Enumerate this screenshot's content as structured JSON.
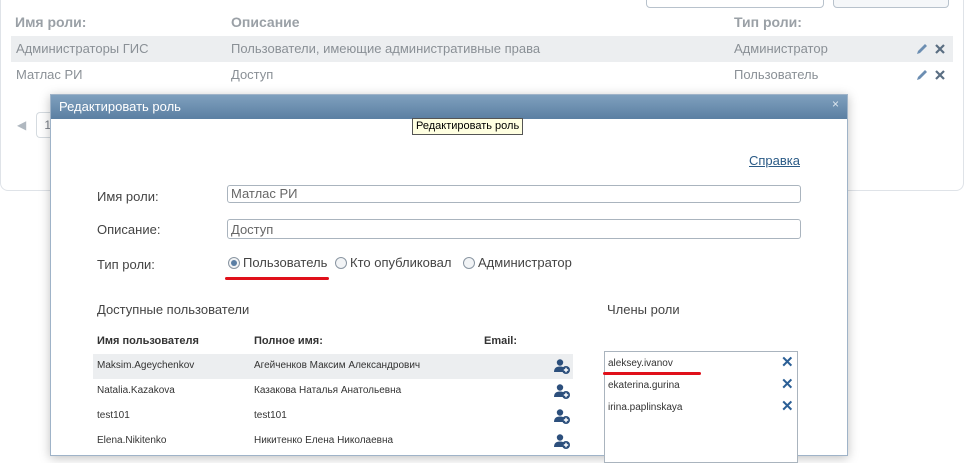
{
  "background": {
    "headers": {
      "role_name": "Имя роли:",
      "description": "Описание",
      "role_type": "Тип роли:"
    },
    "rows": [
      {
        "name": "Администраторы ГИС",
        "description": "Пользователи, имеющие административные права",
        "type": "Администратор"
      },
      {
        "name": "Матлас РИ",
        "description": "Доступ",
        "type": "Пользователь"
      }
    ],
    "pager": {
      "page": "1"
    }
  },
  "dialog": {
    "title": "Редактировать роль",
    "tooltip": "Редактировать роль",
    "help_link": "Справка",
    "labels": {
      "role_name": "Имя роли:",
      "description": "Описание:",
      "role_type": "Тип роли:"
    },
    "values": {
      "role_name": "Матлас РИ",
      "description": "Доступ"
    },
    "role_types": [
      {
        "label": "Пользователь",
        "checked": true
      },
      {
        "label": "Кто опубликовал",
        "checked": false
      },
      {
        "label": "Администратор",
        "checked": false
      }
    ],
    "available_users": {
      "title": "Доступные пользователи",
      "headers": {
        "username": "Имя пользователя",
        "full_name": "Полное имя:",
        "email": "Email:"
      },
      "rows": [
        {
          "username": "Maksim.Ageychenkov",
          "full_name": "Агейченков Максим Александрович"
        },
        {
          "username": "Natalia.Kazakova",
          "full_name": "Казакова Наталья Анатольевна"
        },
        {
          "username": "test101",
          "full_name": "test101"
        },
        {
          "username": "Elena.Nikitenko",
          "full_name": "Никитенко Елена Николаевна"
        }
      ]
    },
    "role_members": {
      "title": "Члены роли",
      "members": [
        "aleksey.ivanov",
        "ekaterina.gurina",
        "irina.paplinskaya"
      ]
    }
  },
  "colors": {
    "accent": "#5b7fa2",
    "highlight_underline": "#e0101a",
    "remove_icon": "#2b5f96"
  }
}
